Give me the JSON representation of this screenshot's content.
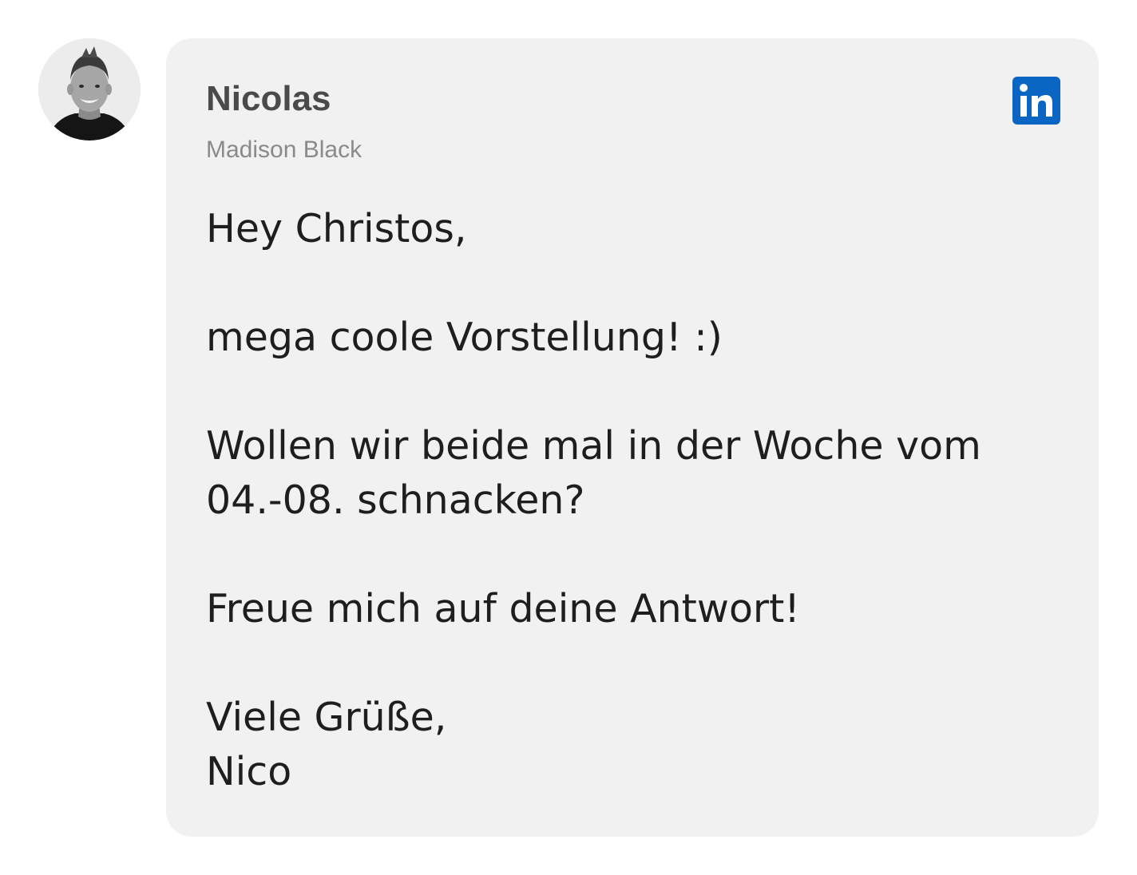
{
  "sender": {
    "name": "Nicolas",
    "subtitle": "Madison Black",
    "avatar_icon": "profile-photo",
    "network_icon": "linkedin-icon",
    "network_color": "#0a66c2"
  },
  "message": {
    "greeting": "Hey Christos,",
    "line1": "mega coole Vorstellung! :)",
    "line2a": "Wollen wir beide mal in der Woche vom",
    "line2b": "04.-08. schnacken?",
    "line3": "Freue mich auf deine Antwort!",
    "closing": "Viele Grüße,",
    "signature": "Nico"
  },
  "colors": {
    "card_background": "#f1f1f1",
    "name_color": "#4a4a4a",
    "subtitle_color": "#8a8a8a",
    "text_color": "#1e1e1e"
  }
}
